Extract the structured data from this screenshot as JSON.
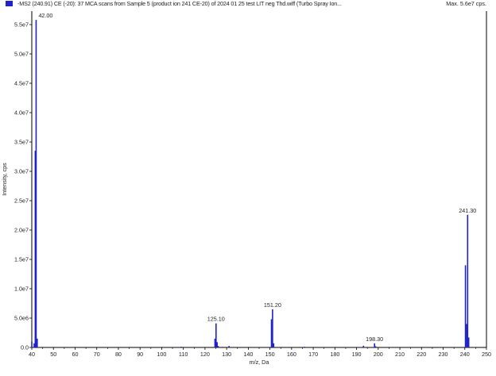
{
  "header": {
    "title": "-MS2 (240.91) CE (-20): 37 MCA scans from Sample 5 (product ion 241 CE-20) of 2024 01 25 test LIT neg Thd.wiff (Turbo Spray Ion...",
    "max_label": "Max. 5.6e7 cps."
  },
  "colors": {
    "series": "#1f23c8",
    "axis": "#000000",
    "text": "#222222"
  },
  "chart_data": {
    "type": "line",
    "title": "",
    "xlabel": "m/z, Da",
    "ylabel": "Intensity, cps",
    "xlim": [
      40,
      250
    ],
    "ylim": [
      0,
      56000000
    ],
    "x_ticks": [
      "40",
      "50",
      "60",
      "70",
      "80",
      "90",
      "100",
      "110",
      "120",
      "130",
      "140",
      "150",
      "160",
      "170",
      "180",
      "190",
      "200",
      "210",
      "220",
      "230",
      "240",
      "250"
    ],
    "y_ticks": [
      {
        "value": 0,
        "label": "0.0"
      },
      {
        "value": 5000000,
        "label": "5.0e6"
      },
      {
        "value": 10000000,
        "label": "1.0e7"
      },
      {
        "value": 15000000,
        "label": "1.5e7"
      },
      {
        "value": 20000000,
        "label": "2.0e7"
      },
      {
        "value": 25000000,
        "label": "2.5e7"
      },
      {
        "value": 30000000,
        "label": "3.0e7"
      },
      {
        "value": 35000000,
        "label": "3.5e7"
      },
      {
        "value": 40000000,
        "label": "4.0e7"
      },
      {
        "value": 45000000,
        "label": "4.5e7"
      },
      {
        "value": 50000000,
        "label": "5.0e7"
      },
      {
        "value": 55000000,
        "label": "5.5e7"
      }
    ],
    "grid": false,
    "peaks": [
      {
        "mz": 40.0,
        "intensity": 1000000
      },
      {
        "mz": 41.1,
        "intensity": 700000
      },
      {
        "mz": 41.6,
        "intensity": 33500000
      },
      {
        "mz": 42.0,
        "intensity": 55800000
      },
      {
        "mz": 42.5,
        "intensity": 1500000
      },
      {
        "mz": 109.0,
        "intensity": 120000
      },
      {
        "mz": 124.6,
        "intensity": 1500000
      },
      {
        "mz": 125.1,
        "intensity": 4100000
      },
      {
        "mz": 125.6,
        "intensity": 900000
      },
      {
        "mz": 126.1,
        "intensity": 250000
      },
      {
        "mz": 128.0,
        "intensity": 100000
      },
      {
        "mz": 131.1,
        "intensity": 250000
      },
      {
        "mz": 150.7,
        "intensity": 4800000
      },
      {
        "mz": 151.2,
        "intensity": 6500000
      },
      {
        "mz": 151.7,
        "intensity": 700000
      },
      {
        "mz": 166.0,
        "intensity": 120000
      },
      {
        "mz": 193.2,
        "intensity": 300000
      },
      {
        "mz": 198.3,
        "intensity": 700000
      },
      {
        "mz": 198.8,
        "intensity": 200000
      },
      {
        "mz": 240.3,
        "intensity": 14000000
      },
      {
        "mz": 240.8,
        "intensity": 4000000
      },
      {
        "mz": 241.3,
        "intensity": 22600000
      },
      {
        "mz": 241.8,
        "intensity": 1700000
      }
    ],
    "labels": [
      {
        "mz": 42.0,
        "intensity": 55800000,
        "text": "42.00"
      },
      {
        "mz": 125.1,
        "intensity": 4100000,
        "text": "125.10"
      },
      {
        "mz": 151.2,
        "intensity": 6500000,
        "text": "151.20"
      },
      {
        "mz": 198.3,
        "intensity": 700000,
        "text": "198.30"
      },
      {
        "mz": 241.3,
        "intensity": 22600000,
        "text": "241.30"
      }
    ]
  }
}
